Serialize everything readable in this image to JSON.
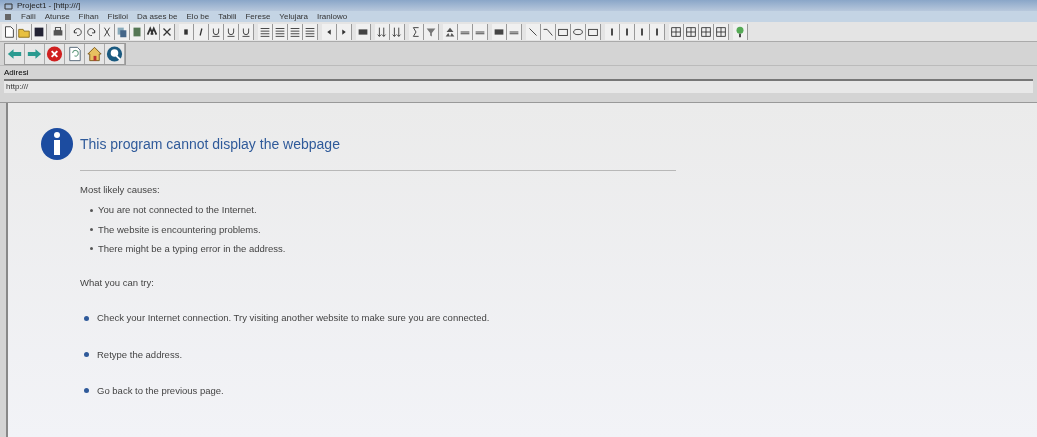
{
  "window": {
    "title": "Project1 - [http:///]"
  },
  "menu": [
    "Faili",
    "Atunse",
    "Fihan",
    "Fisiloi",
    "Da ases be",
    "Elo be",
    "Tabili",
    "Ferese",
    "Yelujara",
    "Iranlowo"
  ],
  "address": {
    "label": "Adiresi",
    "value": "http:///"
  },
  "page": {
    "heading": "This program cannot display the webpage",
    "causes_title": "Most likely causes:",
    "causes": [
      "You are not connected to the Internet.",
      "The website is encountering problems.",
      "There might be a typing error in the address."
    ],
    "try_title": "What you can try:",
    "tries": [
      "Check your Internet connection. Try visiting another website to make sure you are connected.",
      "Retype the address.",
      "Go back to the previous page."
    ]
  }
}
